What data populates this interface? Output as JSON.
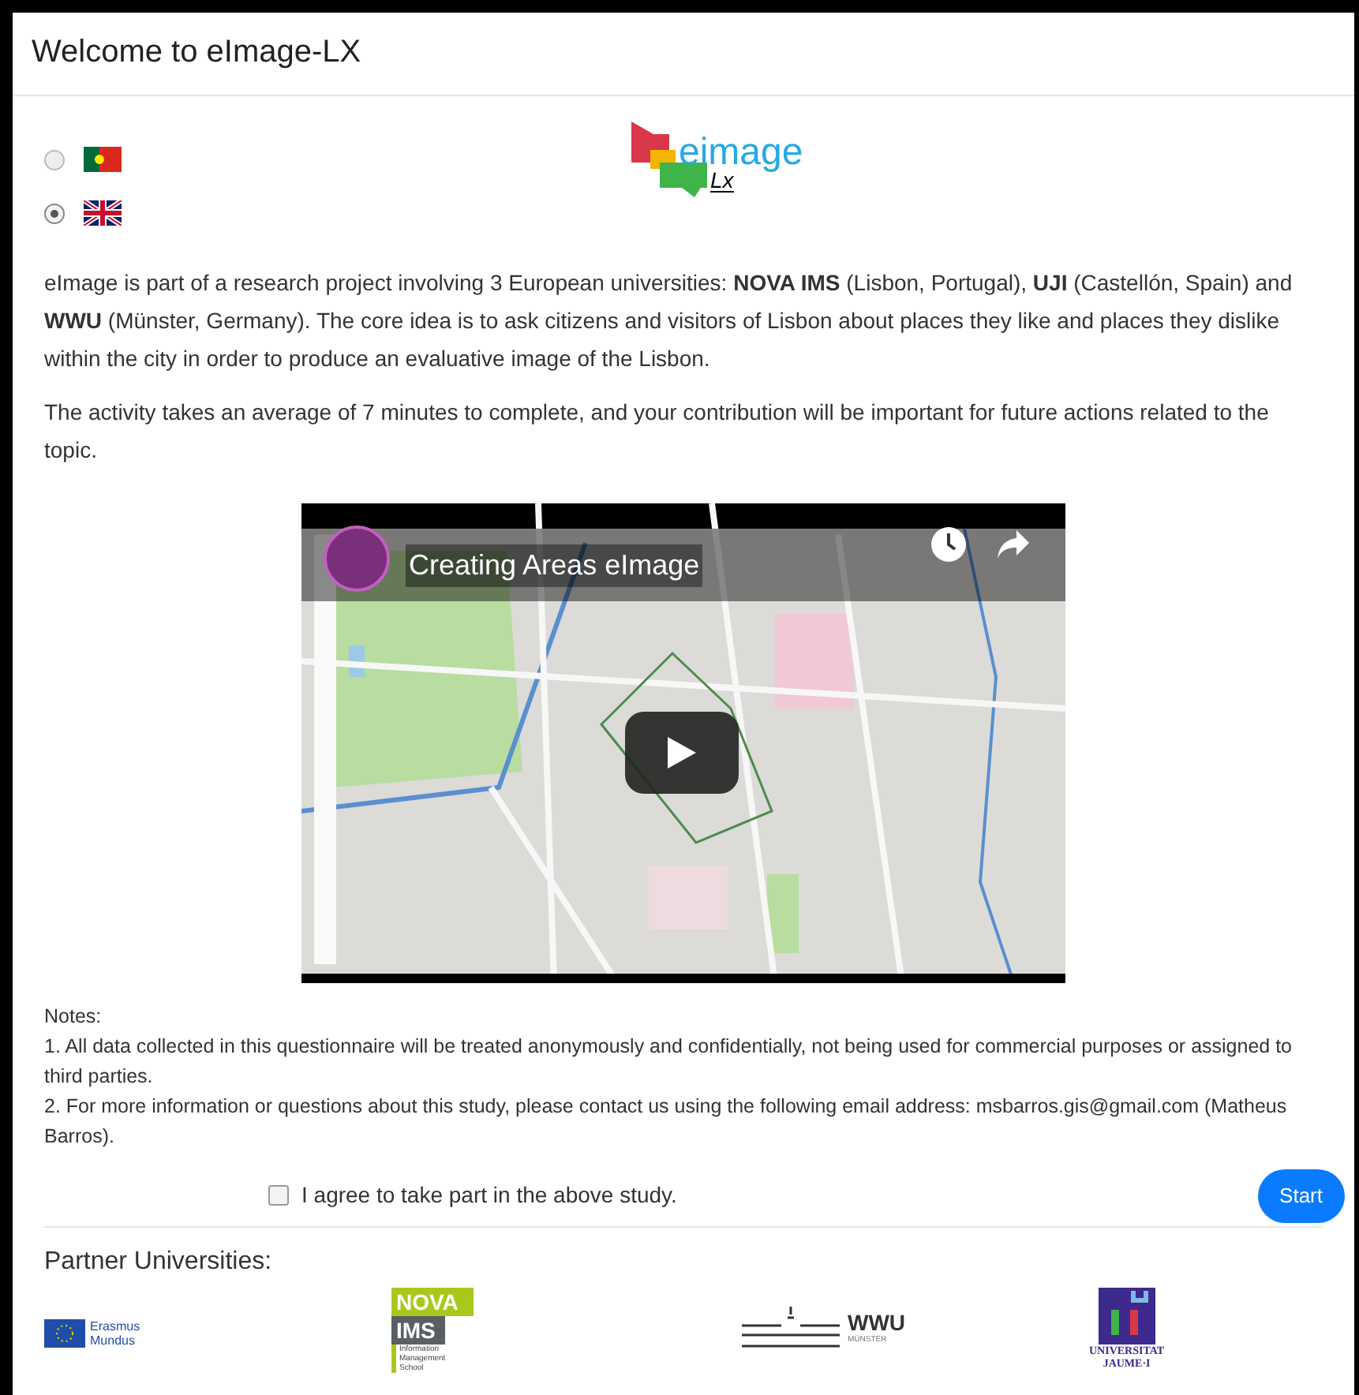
{
  "page": {
    "title": "Welcome to eImage-LX"
  },
  "languages": [
    {
      "kind": "portugal",
      "selected": false
    },
    {
      "kind": "uk",
      "selected": true
    }
  ],
  "logo": {
    "wordmark": "eimage",
    "subtext": "Lx"
  },
  "intro": [
    "eImage is part of a research project involving 3 European universities: **NOVA IMS** (Lisbon, Portugal), **UJI** (Castellón, Spain) and **WWU** (Münster, Germany). The core idea is to ask citizens and visitors of Lisbon about places they like and places they dislike within the city in order to produce an evaluative image of the Lisbon.",
    "The activity takes an average of 7 minutes to complete, and your contribution will be important for future actions related to the topic."
  ],
  "video": {
    "title": "Creating Areas eImage"
  },
  "notes": {
    "heading": "Notes:",
    "items": [
      "1. All data collected in this questionnaire will be treated anonymously and confidentially, not being used for commercial purposes or assigned to third parties.",
      "2. For more information or questions about this study, please contact us using the following email address: msbarros.gis@gmail.com (Matheus Barros)."
    ]
  },
  "consent": {
    "label": "I agree to take part in the above study.",
    "checked": false
  },
  "start_button": "Start",
  "partners": {
    "heading": "Partner Universities:",
    "logos": [
      {
        "kind": "erasmus",
        "lines": [
          "Erasmus",
          "Mundus"
        ]
      },
      {
        "kind": "nova",
        "lines": [
          "NOVA",
          "IMS",
          "Information Management School"
        ]
      },
      {
        "kind": "wwu",
        "lines": [
          "WWU",
          "MÜNSTER"
        ]
      },
      {
        "kind": "jaume",
        "lines": [
          "UNIVERSITAT",
          "JAUME·I"
        ]
      }
    ]
  }
}
